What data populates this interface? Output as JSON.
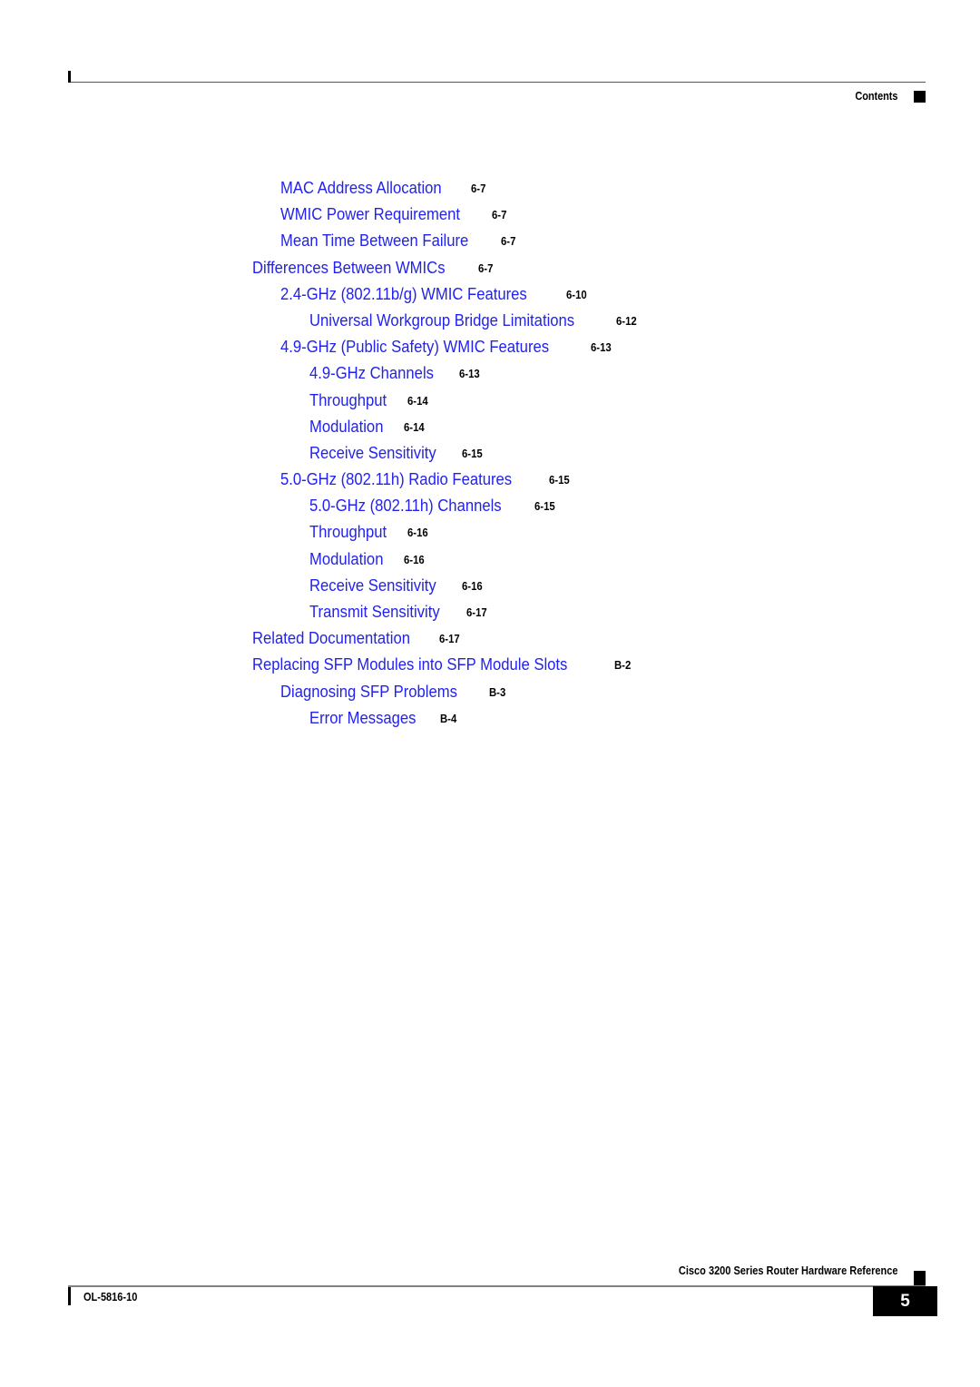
{
  "header": {
    "label": "Contents"
  },
  "toc": {
    "entries": [
      {
        "title": "MAC Address Allocation",
        "page": "6-7",
        "level": 1
      },
      {
        "title": "WMIC Power Requirement",
        "page": "6-7",
        "level": 1
      },
      {
        "title": "Mean Time Between Failure",
        "page": "6-7",
        "level": 1
      },
      {
        "title": "Differences Between WMICs",
        "page": "6-7",
        "level": 0
      },
      {
        "title": "2.4-GHz (802.11b/g) WMIC Features",
        "page": "6-10",
        "level": 1
      },
      {
        "title": "Universal Workgroup Bridge Limitations",
        "page": "6-12",
        "level": 2
      },
      {
        "title": "4.9-GHz (Public Safety) WMIC Features",
        "page": "6-13",
        "level": 1
      },
      {
        "title": "4.9-GHz Channels",
        "page": "6-13",
        "level": 2
      },
      {
        "title": "Throughput",
        "page": "6-14",
        "level": 2
      },
      {
        "title": "Modulation",
        "page": "6-14",
        "level": 2
      },
      {
        "title": "Receive Sensitivity",
        "page": "6-15",
        "level": 2
      },
      {
        "title": "5.0-GHz (802.11h) Radio Features",
        "page": "6-15",
        "level": 1
      },
      {
        "title": "5.0-GHz (802.11h) Channels",
        "page": "6-15",
        "level": 2
      },
      {
        "title": "Throughput",
        "page": "6-16",
        "level": 2
      },
      {
        "title": "Modulation",
        "page": "6-16",
        "level": 2
      },
      {
        "title": "Receive Sensitivity",
        "page": "6-16",
        "level": 2
      },
      {
        "title": "Transmit Sensitivity",
        "page": "6-17",
        "level": 2
      },
      {
        "title": "Related Documentation",
        "page": "6-17",
        "level": 0
      },
      {
        "title": "Replacing SFP Modules into SFP Module Slots",
        "page": "B-2",
        "level": 0
      },
      {
        "title": "Diagnosing SFP Problems",
        "page": "B-3",
        "level": 1
      },
      {
        "title": "Error Messages",
        "page": "B-4",
        "level": 2
      }
    ]
  },
  "footer": {
    "doc_id": "OL-5816-10",
    "title": "Cisco 3200 Series Router Hardware Reference",
    "page_number": "5"
  },
  "colors": {
    "link_blue": "#2222ee",
    "text_black": "#000000",
    "rule_gray": "#555555",
    "footer_rule_gray": "#808080"
  }
}
